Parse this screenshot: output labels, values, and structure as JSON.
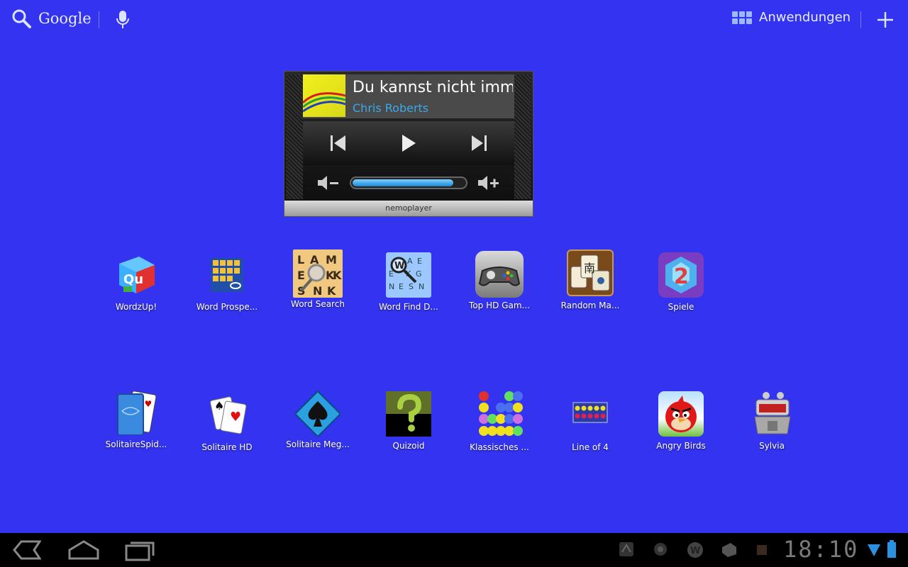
{
  "topbar": {
    "search_label": "Google",
    "apps_label": "Anwendungen"
  },
  "widget": {
    "song_title": "Du kannst nicht imm",
    "artist": "Chris Roberts",
    "brand": "nemoplayer",
    "volume_level": 0.9
  },
  "apps_row1": [
    {
      "label": "WordzUp!",
      "icon": "wordzup-icon"
    },
    {
      "label": "Word Prospe...",
      "icon": "word-prospector-icon"
    },
    {
      "label": "Word Search",
      "icon": "word-search-icon"
    },
    {
      "label": "Word Find D...",
      "icon": "word-find-icon"
    },
    {
      "label": "Top HD Gam...",
      "icon": "gamepad-icon"
    },
    {
      "label": "Random Ma...",
      "icon": "mahjong-icon"
    },
    {
      "label": "Spiele",
      "icon": "spiele-gem-icon"
    }
  ],
  "apps_row2": [
    {
      "label": "SolitaireSpid...",
      "icon": "spider-solitaire-icon"
    },
    {
      "label": "Solitaire HD",
      "icon": "solitaire-cards-icon"
    },
    {
      "label": "Solitaire Meg...",
      "icon": "spade-icon"
    },
    {
      "label": "Quizoid",
      "icon": "question-mark-icon"
    },
    {
      "label": "Klassisches ...",
      "icon": "marbles-icon"
    },
    {
      "label": "Line of 4",
      "icon": "connect-four-icon"
    },
    {
      "label": "Angry Birds",
      "icon": "angry-bird-icon"
    },
    {
      "label": "Sylvia",
      "icon": "robot-icon"
    }
  ],
  "statusbar": {
    "clock": "18:10"
  }
}
